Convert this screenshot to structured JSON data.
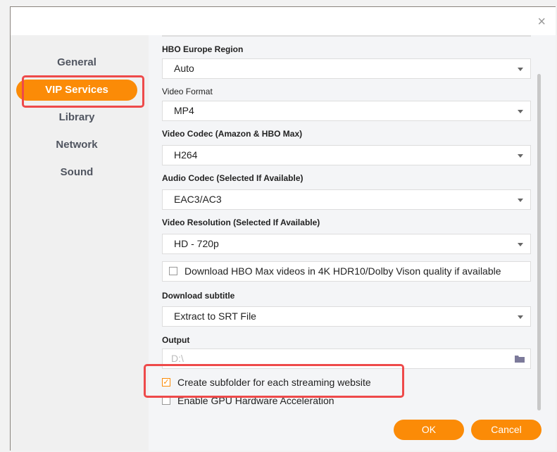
{
  "close_icon": "×",
  "sidebar": {
    "items": [
      {
        "label": "General"
      },
      {
        "label": "VIP Services",
        "active": true
      },
      {
        "label": "Library"
      },
      {
        "label": "Network"
      },
      {
        "label": "Sound"
      }
    ]
  },
  "fields": {
    "hbo_region": {
      "label": "HBO Europe Region",
      "value": "Auto"
    },
    "video_format": {
      "label": "Video Format",
      "value": "MP4"
    },
    "video_codec": {
      "label": "Video Codec (Amazon & HBO Max)",
      "value": "H264"
    },
    "audio_codec": {
      "label": "Audio Codec (Selected If Available)",
      "value": "EAC3/AC3"
    },
    "video_resolution": {
      "label": "Video Resolution (Selected If Available)",
      "value": "HD - 720p"
    },
    "hdr_checkbox": {
      "label": "Download HBO Max videos in 4K HDR10/Dolby Vison quality if available",
      "checked": false
    },
    "subtitle": {
      "label": "Download subtitle",
      "value": "Extract to SRT File"
    },
    "output": {
      "label": "Output",
      "value": "D:\\"
    },
    "subfolder_checkbox": {
      "label": "Create subfolder for each streaming website",
      "checked": true
    },
    "gpu_checkbox": {
      "label": "Enable GPU Hardware Acceleration",
      "checked": false
    }
  },
  "buttons": {
    "ok": "OK",
    "cancel": "Cancel"
  },
  "colors": {
    "accent": "#fb8b07",
    "highlight": "#ee4a4a"
  }
}
